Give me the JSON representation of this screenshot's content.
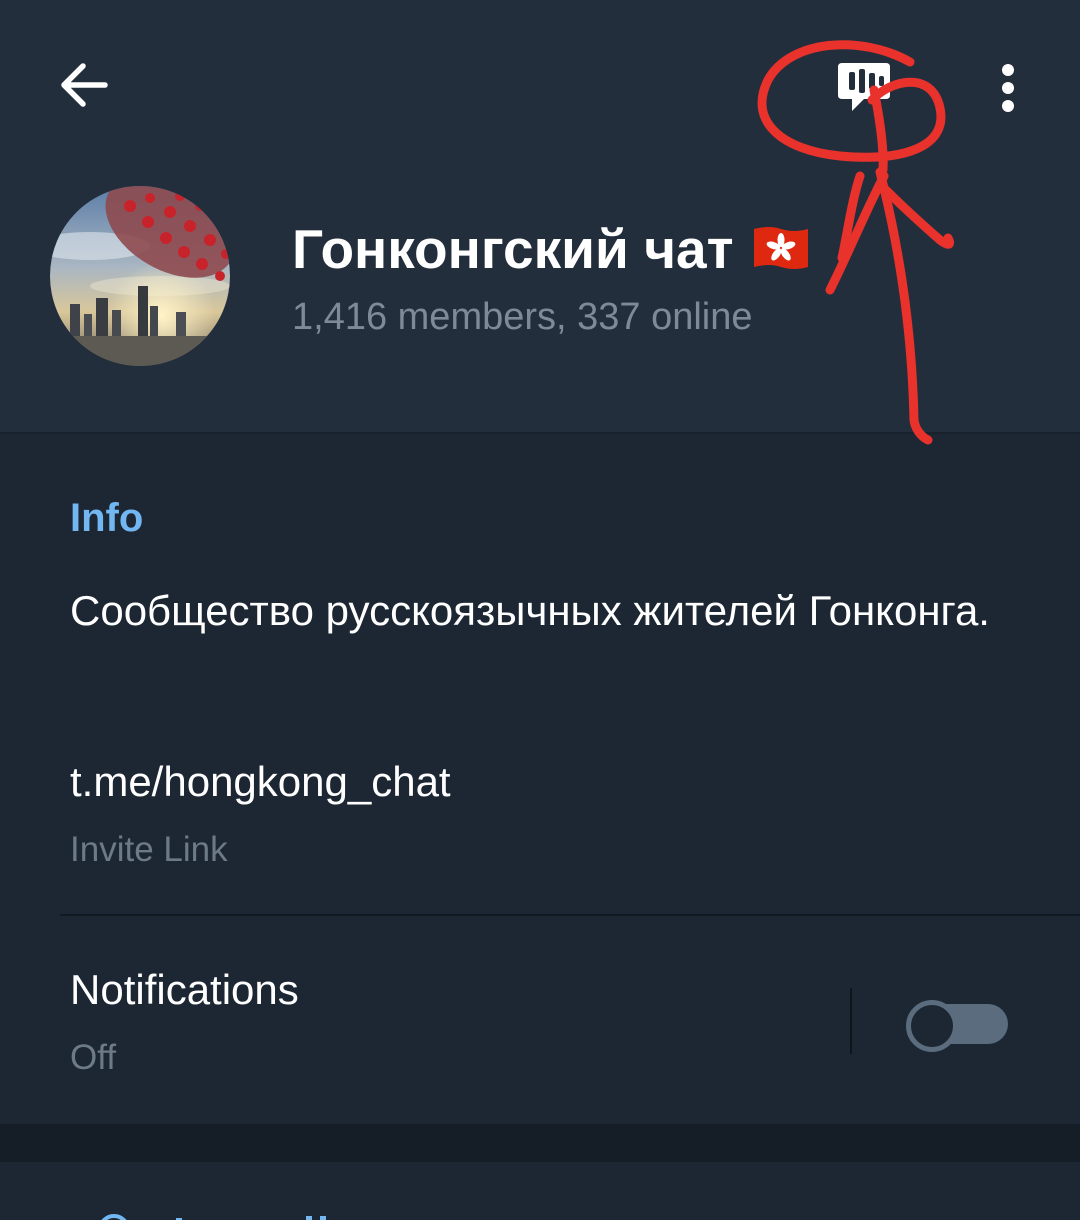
{
  "colors": {
    "header_bg": "#232e3c",
    "page_bg": "#1d2733",
    "accent": "#72b7f2",
    "secondary_text": "#7d8b99",
    "annotation_red": "#e8322b"
  },
  "toolbar": {
    "back_icon": "arrow-left-icon",
    "voice_chat_icon": "voice-chat-icon",
    "more_icon": "more-vertical-icon"
  },
  "group": {
    "title": "Гонконгский чат",
    "flag_icon": "hong-kong-flag-icon",
    "subtitle": "1,416 members, 337 online"
  },
  "info": {
    "heading": "Info",
    "description": "Сообщество русскоязычных жителей Гонконга.",
    "invite_link": "t.me/hongkong_chat",
    "invite_label": "Invite Link"
  },
  "notifications": {
    "title": "Notifications",
    "value": "Off",
    "enabled": false
  }
}
